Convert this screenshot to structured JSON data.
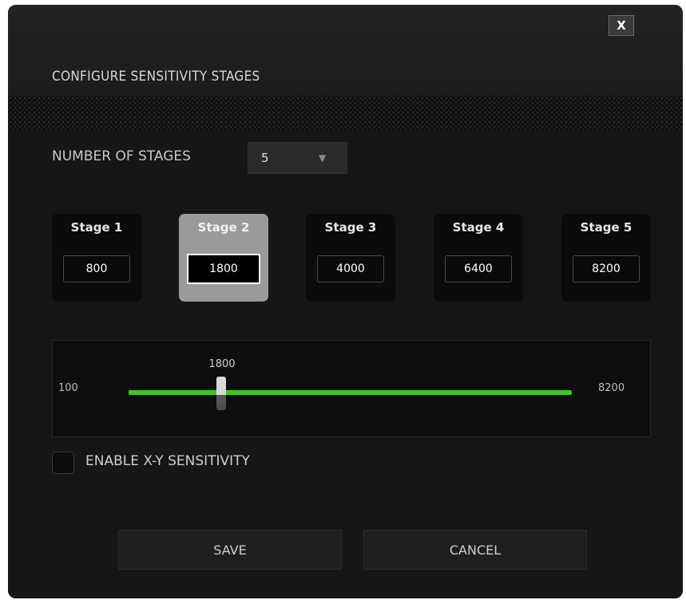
{
  "dialog": {
    "title": "CONFIGURE SENSITIVITY STAGES",
    "close_label": "X"
  },
  "stages_selector": {
    "label": "NUMBER OF STAGES",
    "selected": "5",
    "caret_icon": "caret-down-icon"
  },
  "stages": [
    {
      "label": "Stage 1",
      "value": "800",
      "active": false
    },
    {
      "label": "Stage 2",
      "value": "1800",
      "active": true
    },
    {
      "label": "Stage 3",
      "value": "4000",
      "active": false
    },
    {
      "label": "Stage 4",
      "value": "6400",
      "active": false
    },
    {
      "label": "Stage 5",
      "value": "8200",
      "active": false
    }
  ],
  "slider": {
    "min_label": "100",
    "max_label": "8200",
    "current_label": "1800",
    "min": 100,
    "max": 8200,
    "value": 1800,
    "track_color": "#33d10f"
  },
  "xy_sensitivity": {
    "label": "ENABLE X-Y SENSITIVITY",
    "checked": false
  },
  "buttons": {
    "save_label": "SAVE",
    "cancel_label": "CANCEL"
  }
}
